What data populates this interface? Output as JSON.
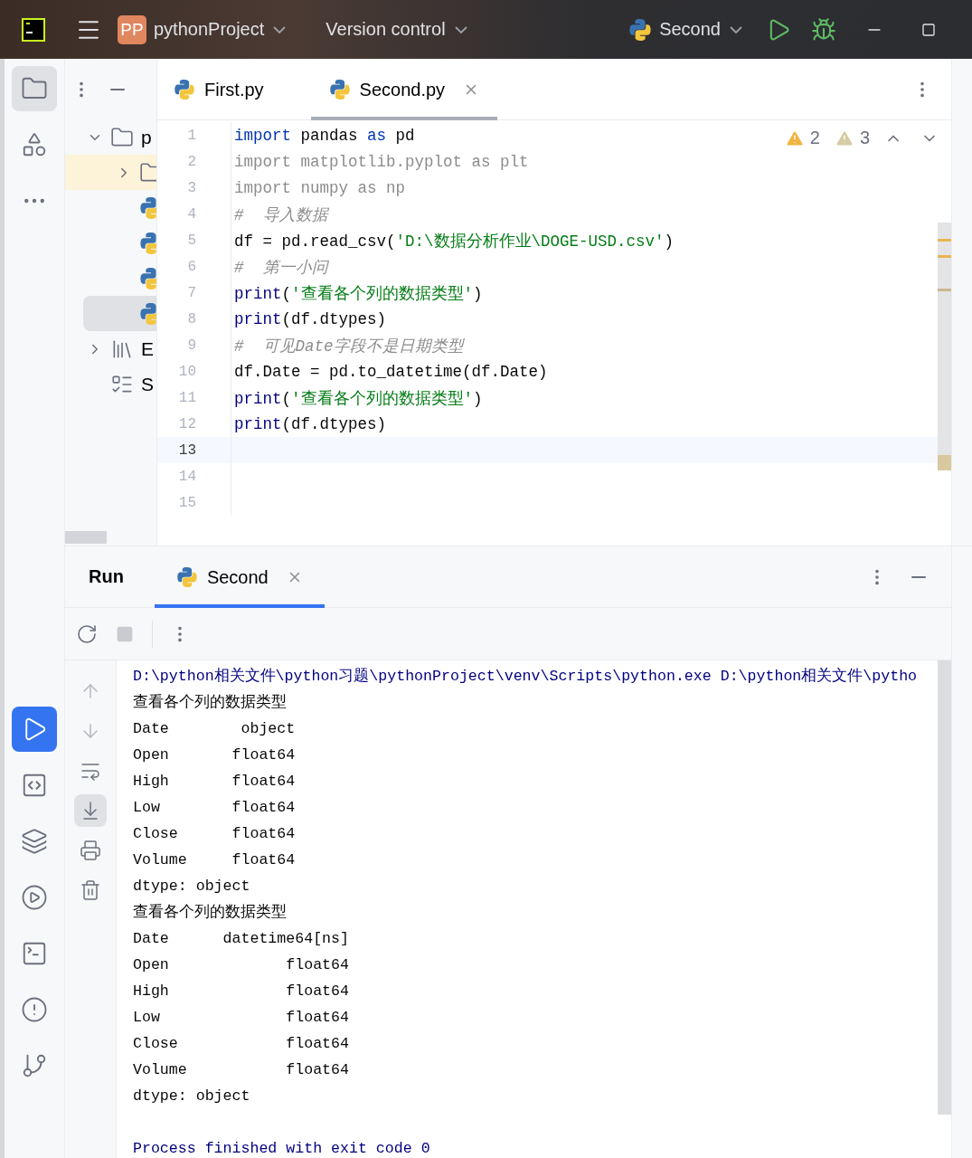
{
  "titlebar": {
    "project_badge": "PP",
    "project": "pythonProject",
    "vcs": "Version control",
    "run_config": "Second"
  },
  "left_tools": [
    {
      "kind": "folder",
      "selected": true
    },
    {
      "kind": "structure",
      "selected": false
    },
    {
      "kind": "more",
      "selected": false
    },
    {
      "kind": "run",
      "selected": true
    },
    {
      "kind": "python-console",
      "selected": false
    },
    {
      "kind": "layers",
      "selected": false
    },
    {
      "kind": "services",
      "selected": false
    },
    {
      "kind": "terminal",
      "selected": false
    },
    {
      "kind": "problems",
      "selected": false
    },
    {
      "kind": "git",
      "selected": false
    }
  ],
  "project_tree": [
    {
      "kind": "folder",
      "label": "p",
      "expanded": true,
      "selected": false,
      "children": [
        {
          "kind": "excluded-folder",
          "expanded": false,
          "selected": false
        },
        {
          "kind": "python-file",
          "selected": false
        },
        {
          "kind": "python-file",
          "selected": false
        },
        {
          "kind": "python-file",
          "selected": false
        },
        {
          "kind": "python-file",
          "selected": true
        }
      ]
    },
    {
      "kind": "libraries",
      "label": "E",
      "expanded": false,
      "selected": false
    },
    {
      "kind": "scratches",
      "label": "S",
      "selected": false
    }
  ],
  "editor": {
    "tabs": [
      {
        "label": "First.py",
        "selected": false
      },
      {
        "label": "Second.py",
        "selected": true
      }
    ],
    "warnings": "2",
    "weak_warnings": "3",
    "lines": [
      {
        "number": "1",
        "current": false,
        "tokens": [
          {
            "kind": "keyword",
            "text": "import"
          },
          {
            "kind": "plain",
            "text": " pandas "
          },
          {
            "kind": "keyword",
            "text": "as"
          },
          {
            "kind": "plain",
            "text": " pd"
          }
        ]
      },
      {
        "number": "2",
        "current": false,
        "tokens": [
          {
            "kind": "unused",
            "text": "import matplotlib.pyplot as plt"
          }
        ]
      },
      {
        "number": "3",
        "current": false,
        "tokens": [
          {
            "kind": "unused",
            "text": "import numpy as np"
          }
        ]
      },
      {
        "number": "4",
        "current": false,
        "tokens": [
          {
            "kind": "comment",
            "text": "#  导入数据"
          }
        ]
      },
      {
        "number": "5",
        "current": false,
        "tokens": [
          {
            "kind": "plain",
            "text": "df = pd.read_csv("
          },
          {
            "kind": "string",
            "text": "'D:\\数据分析作业\\DOGE-USD.csv'"
          },
          {
            "kind": "plain",
            "text": ")"
          }
        ]
      },
      {
        "number": "6",
        "current": false,
        "tokens": [
          {
            "kind": "comment",
            "text": "#  第一小问"
          }
        ]
      },
      {
        "number": "7",
        "current": false,
        "tokens": [
          {
            "kind": "builtin",
            "text": "print"
          },
          {
            "kind": "plain",
            "text": "("
          },
          {
            "kind": "string",
            "text": "'查看各个列的数据类型'"
          },
          {
            "kind": "plain",
            "text": ")"
          }
        ]
      },
      {
        "number": "8",
        "current": false,
        "tokens": [
          {
            "kind": "builtin",
            "text": "print"
          },
          {
            "kind": "plain",
            "text": "(df.dtypes)"
          }
        ]
      },
      {
        "number": "9",
        "current": false,
        "tokens": [
          {
            "kind": "comment",
            "text": "#  可见Date字段不是日期类型"
          }
        ]
      },
      {
        "number": "10",
        "current": false,
        "tokens": [
          {
            "kind": "plain",
            "text": "df.Date = pd.to_datetime(df.Date)"
          }
        ]
      },
      {
        "number": "11",
        "current": false,
        "tokens": [
          {
            "kind": "builtin",
            "text": "print"
          },
          {
            "kind": "plain",
            "text": "("
          },
          {
            "kind": "string",
            "text": "'查看各个列的数据类型'"
          },
          {
            "kind": "plain",
            "text": ")"
          }
        ]
      },
      {
        "number": "12",
        "current": false,
        "tokens": [
          {
            "kind": "builtin",
            "text": "print"
          },
          {
            "kind": "plain",
            "text": "(df.dtypes)"
          }
        ]
      },
      {
        "number": "13",
        "current": true
      },
      {
        "number": "14",
        "current": false
      },
      {
        "number": "15",
        "current": false
      }
    ]
  },
  "run": {
    "title": "Run",
    "tabs": [
      {
        "label": "Second",
        "selected": true
      }
    ],
    "side_tools": [
      {
        "kind": "up",
        "selected": false
      },
      {
        "kind": "down",
        "selected": false
      },
      {
        "kind": "wrap",
        "selected": false
      },
      {
        "kind": "scroll-end",
        "selected": true
      },
      {
        "kind": "print",
        "selected": false
      },
      {
        "kind": "trash",
        "selected": false
      }
    ],
    "console": [
      {
        "kind": "command",
        "text": "D:\\python相关文件\\python习题\\pythonProject\\venv\\Scripts\\python.exe D:\\python相关文件\\pytho"
      },
      {
        "kind": "output",
        "text": "查看各个列的数据类型"
      },
      {
        "kind": "output",
        "text": "Date        object"
      },
      {
        "kind": "output",
        "text": "Open       float64"
      },
      {
        "kind": "output",
        "text": "High       float64"
      },
      {
        "kind": "output",
        "text": "Low        float64"
      },
      {
        "kind": "output",
        "text": "Close      float64"
      },
      {
        "kind": "output",
        "text": "Volume     float64"
      },
      {
        "kind": "output",
        "text": "dtype: object"
      },
      {
        "kind": "output",
        "text": "查看各个列的数据类型"
      },
      {
        "kind": "output",
        "text": "Date      datetime64[ns]"
      },
      {
        "kind": "output",
        "text": "Open             float64"
      },
      {
        "kind": "output",
        "text": "High             float64"
      },
      {
        "kind": "output",
        "text": "Low              float64"
      },
      {
        "kind": "output",
        "text": "Close            float64"
      },
      {
        "kind": "output",
        "text": "Volume           float64"
      },
      {
        "kind": "output",
        "text": "dtype: object"
      },
      {
        "kind": "blank"
      },
      {
        "kind": "status",
        "text": "Process finished with exit code 0"
      }
    ]
  }
}
